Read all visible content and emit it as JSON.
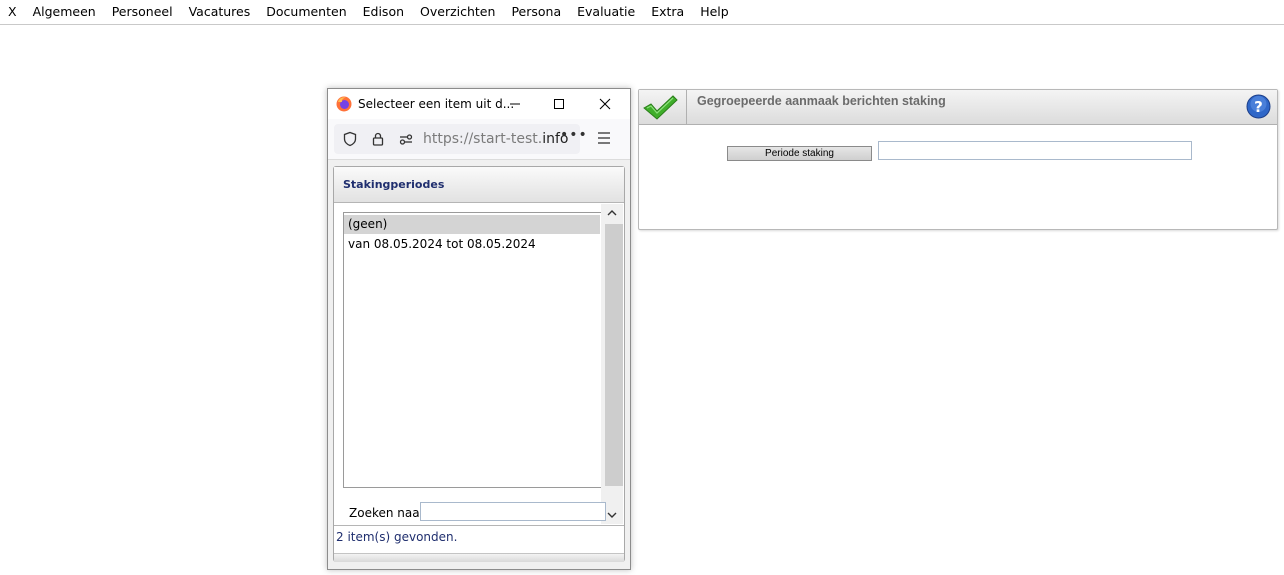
{
  "menu": {
    "items": [
      "X",
      "Algemeen",
      "Personeel",
      "Vacatures",
      "Documenten",
      "Edison",
      "Overzichten",
      "Persona",
      "Evaluatie",
      "Extra",
      "Help"
    ]
  },
  "panel": {
    "title": "Gegroepeerde aanmaak berichten staking",
    "periode_button": "Periode staking",
    "periode_value": "",
    "check_icon": "check-icon",
    "help_icon": "help-icon"
  },
  "popup": {
    "window_title": "Selecteer een item uit d...",
    "url_prefix": "https://start-test.",
    "url_domain": "info",
    "url_more": "•••",
    "section_title": "Stakingperiodes",
    "list_items": [
      "(geen)",
      "van 08.05.2024 tot 08.05.2024"
    ],
    "selected_index": 0,
    "search_label": "Zoeken naar:",
    "search_value": "",
    "status": "2 item(s) gevonden.",
    "colors": {
      "selection": "#d4d4d4",
      "title_blue": "#1f2e6e"
    }
  }
}
